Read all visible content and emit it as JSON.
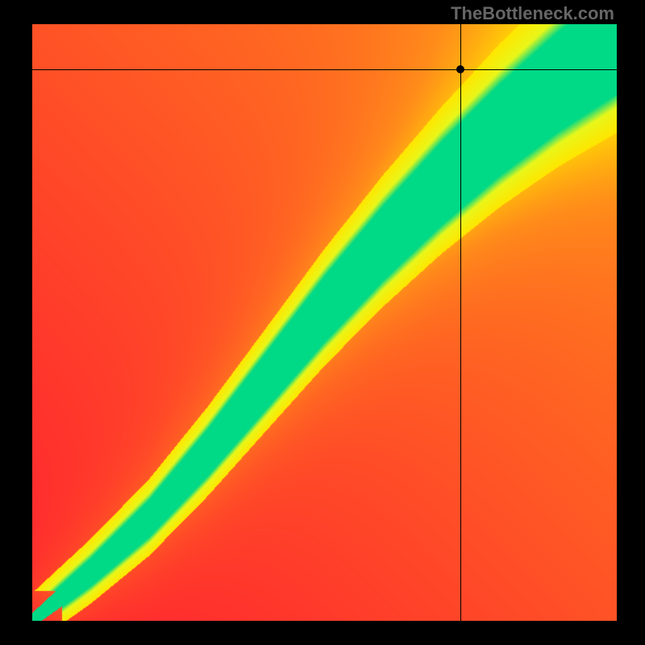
{
  "watermark": "TheBottleneck.com",
  "chart_data": {
    "type": "heatmap",
    "title": "",
    "xlabel": "",
    "ylabel": "",
    "xlim": [
      0,
      1
    ],
    "ylim": [
      0,
      1
    ],
    "crosshair": {
      "x": 0.733,
      "y": 0.925
    },
    "marker": {
      "x": 0.733,
      "y": 0.925
    },
    "color_stops": [
      {
        "value": 0.0,
        "color": "#ff2030"
      },
      {
        "value": 0.45,
        "color": "#ff8c1a"
      },
      {
        "value": 0.7,
        "color": "#ffe600"
      },
      {
        "value": 0.88,
        "color": "#e8f71a"
      },
      {
        "value": 1.0,
        "color": "#00d986"
      }
    ],
    "ridge": {
      "description": "Optimal diagonal band from bottom-left to top-right; green where balanced, fading to yellow/orange/red away from ridge",
      "points_xy": [
        [
          0.0,
          0.0
        ],
        [
          0.1,
          0.08
        ],
        [
          0.2,
          0.17
        ],
        [
          0.3,
          0.28
        ],
        [
          0.4,
          0.4
        ],
        [
          0.5,
          0.52
        ],
        [
          0.6,
          0.63
        ],
        [
          0.7,
          0.73
        ],
        [
          0.8,
          0.82
        ],
        [
          0.9,
          0.9
        ],
        [
          1.0,
          0.97
        ]
      ],
      "band_halfwidth_start": 0.005,
      "band_halfwidth_end": 0.07
    }
  }
}
